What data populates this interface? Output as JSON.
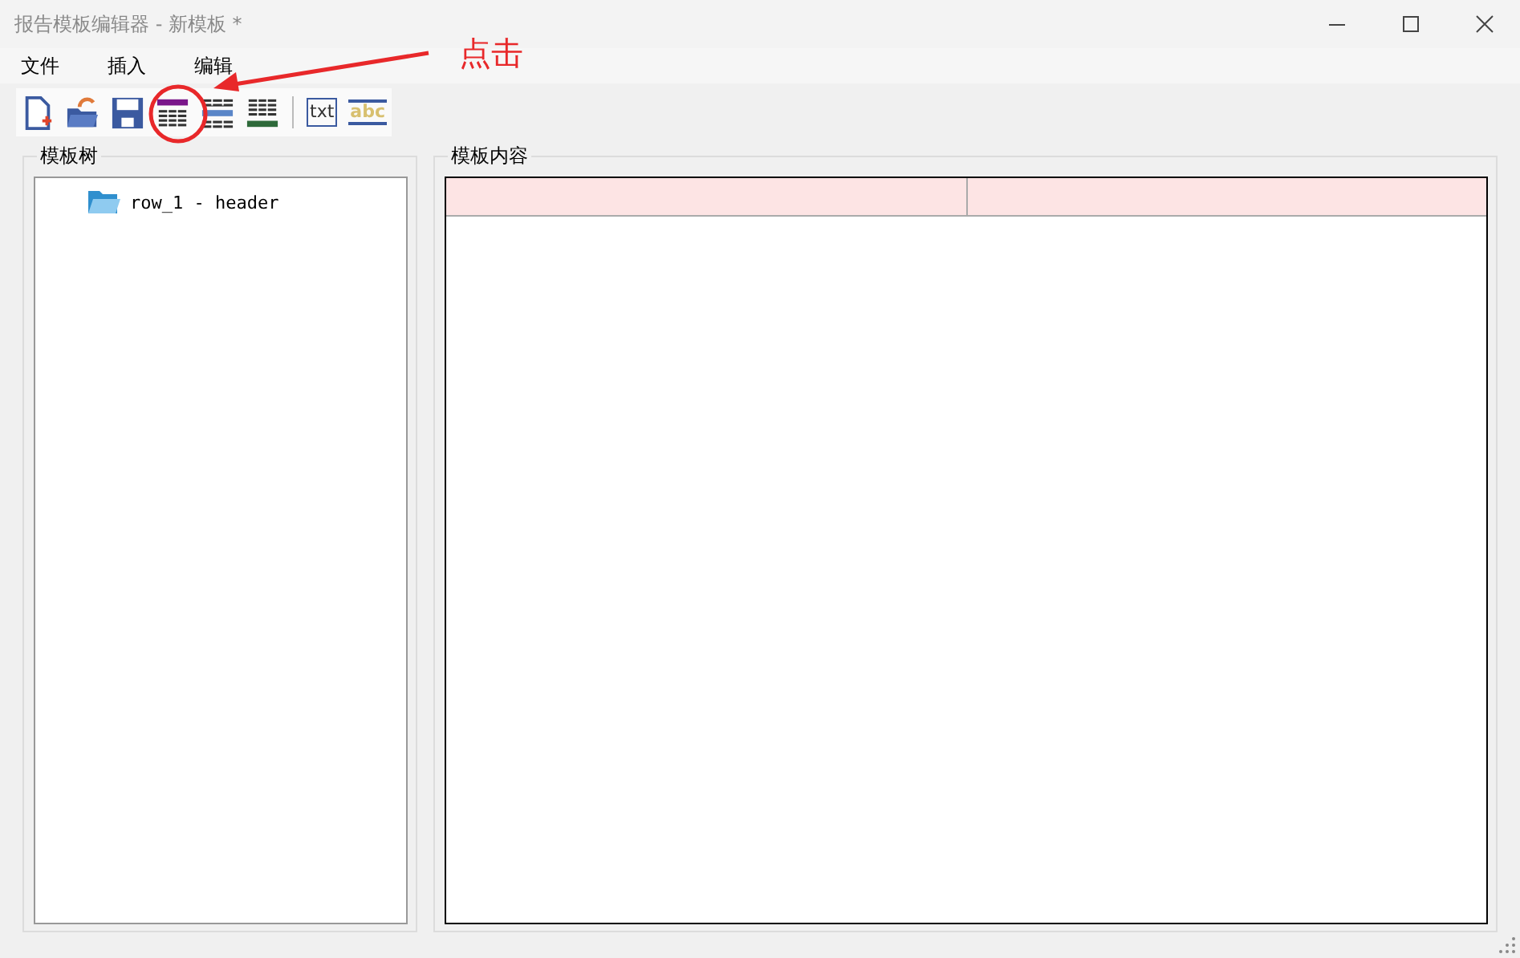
{
  "window": {
    "title": "报告模板编辑器 - 新模板 *"
  },
  "menu": [
    "文件",
    "插入",
    "编辑"
  ],
  "toolbar": [
    {
      "kind": "new"
    },
    {
      "kind": "open"
    },
    {
      "kind": "save"
    },
    {
      "kind": "table-header"
    },
    {
      "kind": "table-band"
    },
    {
      "kind": "table-footer"
    },
    {
      "kind": "separator"
    },
    {
      "kind": "text",
      "label": "txt"
    },
    {
      "kind": "label",
      "label": "abc"
    }
  ],
  "tree_panel": {
    "title": "模板树",
    "items": [
      {
        "label": "row_1 - header"
      }
    ]
  },
  "content_panel": {
    "title": "模板内容",
    "header_cells": [
      {
        "kind": "cell"
      },
      {
        "kind": "cell"
      }
    ]
  },
  "annotation": {
    "label": "点击"
  }
}
